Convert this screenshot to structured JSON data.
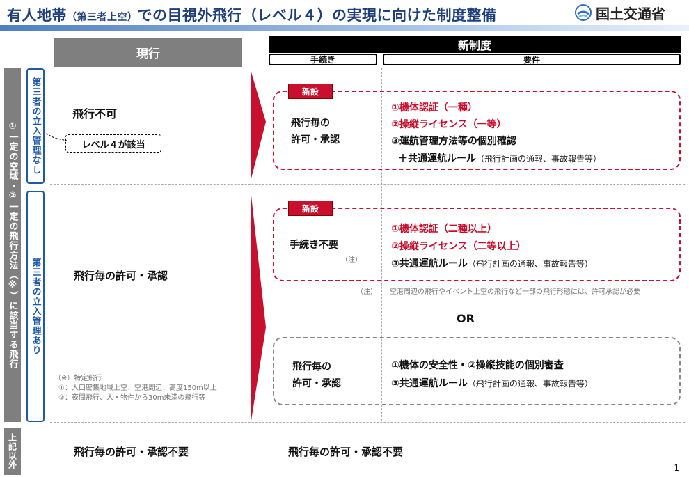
{
  "header": {
    "title_part1": "有人地帯",
    "title_small": "（第三者上空）",
    "title_part2": "での目視外飛行（レベル４）の実現に向けた制度整備",
    "org": "国土交通省"
  },
  "columns": {
    "current": "現行",
    "new": "新制度",
    "procedure": "手続き",
    "requirements": "要件"
  },
  "left_labels": {
    "category": "①一定の空域・②一定の飛行方法（※）に該当する飛行",
    "no_mgmt": "第三者の立入管理なし",
    "with_mgmt": "第三者の立入管理あり",
    "other": "上記以外"
  },
  "current": {
    "row1": "飛行不可",
    "level4": "レベル４が該当",
    "row2": "飛行毎の許可・承認",
    "note_title": "（※）特定飛行",
    "note1": "①：人口密集地域上空、空港周辺、高度150m以上",
    "note2": "②：夜間飛行、人・物件から30m未満の飛行等",
    "row3": "飛行毎の許可・承認不要"
  },
  "new": {
    "badge": "新設",
    "block1": {
      "proc_line1": "飛行毎の",
      "proc_line2": "許可・承認",
      "req1": "①機体認証（一種）",
      "req2": "②操縦ライセンス（一等）",
      "req3": "③運航管理方法等の個別確認",
      "req4_main": "＋共通運航ルール",
      "req4_paren": "（飛行計画の通報、事故報告等）"
    },
    "block2": {
      "proc": "手続き不要",
      "proc_note": "（注）",
      "req1": "①機体認証（二種以上）",
      "req2": "②操縦ライセンス（二等以上）",
      "req3_main": "③共通運航ルール",
      "req3_paren": "（飛行計画の通報、事故報告等）"
    },
    "note_label": "（注）",
    "note_text": "空港周辺の飛行やイベント上空の飛行など一部の飛行形態には、許可承認が必要",
    "or": "OR",
    "block3": {
      "proc_line1": "飛行毎の",
      "proc_line2": "許可・承認",
      "req1": "①機体の安全性・②操縦技能の個別審査",
      "req2_main": "③共通運航ルール",
      "req2_paren": "（飛行計画の通報、事故報告等）"
    },
    "row3": "飛行毎の許可・承認不要"
  },
  "page_number": "1",
  "colors": {
    "title": "#1e3f7a",
    "accent_red": "#c8102e",
    "blue_border": "#1f5aa8",
    "gray": "#7f7f7f"
  }
}
